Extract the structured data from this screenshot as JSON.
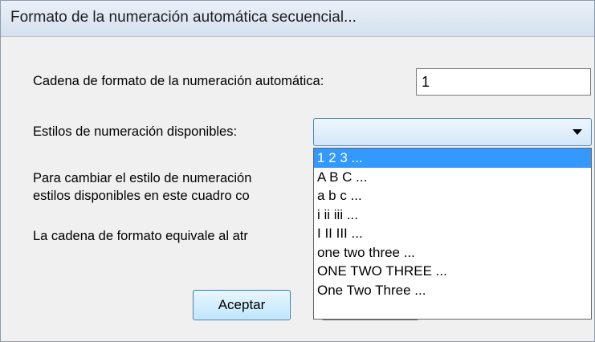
{
  "window": {
    "title": "Formato de la numeración automática secuencial..."
  },
  "format_string": {
    "label": "Cadena de formato de la numeración automática:",
    "value": "1"
  },
  "styles": {
    "label": "Estilos de numeración disponibles:",
    "selected_value": "",
    "options": [
      "1 2 3 ...",
      "A B C ...",
      "a b c ...",
      "i ii iii ...",
      "I II III ...",
      "one two three ...",
      "ONE TWO THREE ...",
      "One Two Three ..."
    ],
    "highlighted_index": 0
  },
  "info": {
    "line1": "Para cambiar el estilo de numeración",
    "line2": "estilos disponibles en este cuadro co",
    "line3": "La cadena de formato equivale al atr"
  },
  "buttons": {
    "ok_label": "Aceptar"
  },
  "colors": {
    "selection": "#3399ff",
    "dialog_bg": "#f0f0f0"
  }
}
